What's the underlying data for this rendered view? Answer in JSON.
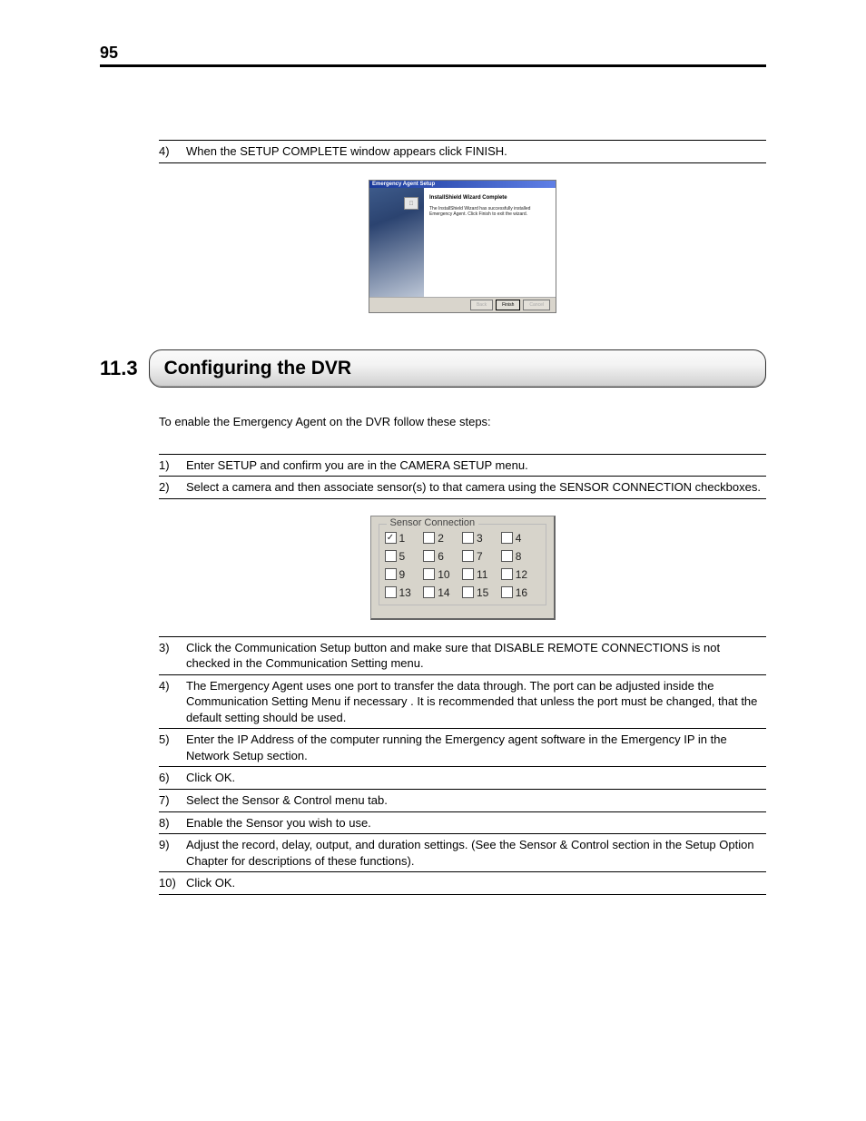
{
  "page_number": "95",
  "top_steps": [
    {
      "num": "4)",
      "text": "When the SETUP COMPLETE window appears click FINISH."
    }
  ],
  "installer": {
    "title": "Emergency Agent Setup",
    "heading": "InstallShield Wizard Complete",
    "body": "The InstallShield Wizard has successfully installed Emergency Agent. Click Finish to exit the wizard.",
    "buttons": {
      "back": "Back",
      "finish": "Finish",
      "cancel": "Cancel"
    }
  },
  "section": {
    "number": "11.3",
    "title": "Configuring the DVR"
  },
  "intro": "To enable the Emergency Agent on the DVR follow these steps:",
  "steps_a": [
    {
      "num": "1)",
      "text": "Enter SETUP and confirm you are in the CAMERA SETUP menu."
    },
    {
      "num": "2)",
      "text": "Select a camera and then associate sensor(s) to that camera using the SENSOR CONNECTION checkboxes."
    }
  ],
  "sensor": {
    "legend": "Sensor Connection",
    "items": [
      {
        "label": "1",
        "checked": true
      },
      {
        "label": "2",
        "checked": false
      },
      {
        "label": "3",
        "checked": false
      },
      {
        "label": "4",
        "checked": false
      },
      {
        "label": "5",
        "checked": false
      },
      {
        "label": "6",
        "checked": false
      },
      {
        "label": "7",
        "checked": false
      },
      {
        "label": "8",
        "checked": false
      },
      {
        "label": "9",
        "checked": false
      },
      {
        "label": "10",
        "checked": false
      },
      {
        "label": "11",
        "checked": false
      },
      {
        "label": "12",
        "checked": false
      },
      {
        "label": "13",
        "checked": false
      },
      {
        "label": "14",
        "checked": false
      },
      {
        "label": "15",
        "checked": false
      },
      {
        "label": "16",
        "checked": false
      }
    ]
  },
  "steps_b": [
    {
      "num": "3)",
      "text": "Click the Communication Setup button and make sure that DISABLE REMOTE CONNECTIONS is not checked in the Communication Setting menu."
    },
    {
      "num": "4)",
      "text": "The Emergency Agent uses one port to transfer the data through. The port can be adjusted inside the Communication Setting Menu  if necessary . It is recommended that unless the port must be changed, that the default setting should be used."
    },
    {
      "num": "5)",
      "text": "Enter the IP Address of the computer running the Emergency agent software in the Emergency IP in the Network Setup section."
    },
    {
      "num": "6)",
      "text": "Click OK."
    },
    {
      "num": "7)",
      "text": "Select the Sensor & Control menu tab."
    },
    {
      "num": "8)",
      "text": "Enable the Sensor you wish to use."
    },
    {
      "num": "9)",
      "text": "Adjust the record, delay, output, and duration settings. (See the Sensor & Control section in the Setup Option Chapter for descriptions of these functions)."
    },
    {
      "num": "10)",
      "text": "Click OK."
    }
  ]
}
